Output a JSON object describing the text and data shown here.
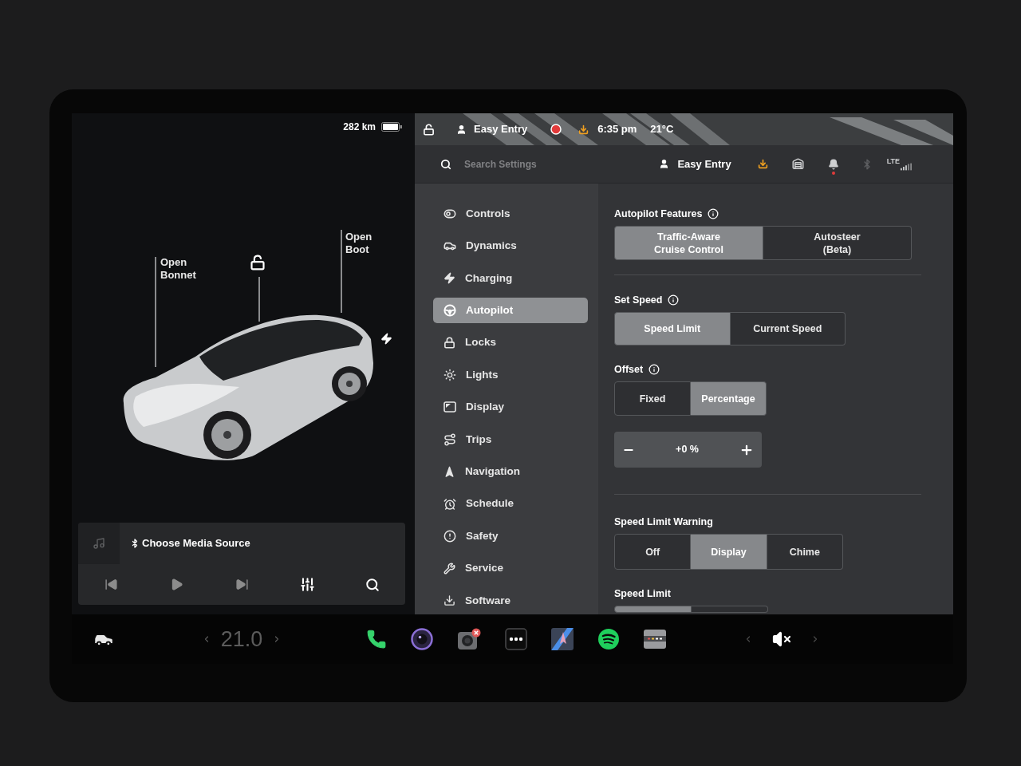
{
  "vehicle_panel": {
    "range": "282 km",
    "hotspots": [
      {
        "kind": "label",
        "text": "Open\nBonnet"
      },
      {
        "kind": "lock",
        "locked": false
      },
      {
        "kind": "label",
        "text": "Open\nBoot"
      }
    ]
  },
  "media_player": {
    "prompt": "Choose Media Source"
  },
  "status_bar": {
    "locked": false,
    "profile": "Easy Entry",
    "recording": true,
    "time": "6:35 pm",
    "temperature": "21°C"
  },
  "settings_header": {
    "search": {
      "placeholder": "Search Settings"
    },
    "profile": "Easy Entry",
    "notification": true,
    "bluetooth_connected": false,
    "network": "LTE"
  },
  "menu": [
    {
      "label": "Controls",
      "selected": false
    },
    {
      "label": "Dynamics",
      "selected": false
    },
    {
      "label": "Charging",
      "selected": false
    },
    {
      "label": "Autopilot",
      "selected": true
    },
    {
      "label": "Locks",
      "selected": false
    },
    {
      "label": "Lights",
      "selected": false
    },
    {
      "label": "Display",
      "selected": false
    },
    {
      "label": "Trips",
      "selected": false
    },
    {
      "label": "Navigation",
      "selected": false
    },
    {
      "label": "Schedule",
      "selected": false
    },
    {
      "label": "Safety",
      "selected": false
    },
    {
      "label": "Service",
      "selected": false
    },
    {
      "label": "Software",
      "selected": false
    }
  ],
  "settings": {
    "groups": [
      {
        "sections": [
          {
            "kind": "segmented",
            "title": "Autopilot Features",
            "info": true,
            "options": [
              {
                "label": "Traffic-Aware\nCruise Control",
                "selected": true
              },
              {
                "label": "Autosteer\n(Beta)",
                "selected": false
              }
            ]
          }
        ]
      },
      {
        "sections": [
          {
            "kind": "segmented",
            "title": "Set Speed",
            "info": true,
            "options": [
              {
                "label": "Speed Limit",
                "selected": true
              },
              {
                "label": "Current Speed",
                "selected": false
              }
            ]
          },
          {
            "kind": "segmented",
            "title": "Offset",
            "info": true,
            "options": [
              {
                "label": "Fixed",
                "selected": false
              },
              {
                "label": "Percentage",
                "selected": true
              }
            ]
          },
          {
            "kind": "stepper",
            "value": "+0 %"
          }
        ]
      },
      {
        "sections": [
          {
            "kind": "segmented",
            "title": "Speed Limit Warning",
            "info": false,
            "options": [
              {
                "label": "Off",
                "selected": false
              },
              {
                "label": "Display",
                "selected": true
              },
              {
                "label": "Chime",
                "selected": false
              }
            ]
          },
          {
            "kind": "segmented",
            "title": "Speed Limit",
            "info": false,
            "options": [
              {
                "selected": true
              },
              {
                "selected": false
              }
            ]
          }
        ]
      }
    ]
  },
  "dock": {
    "temperature": "21.0",
    "muted": true
  }
}
